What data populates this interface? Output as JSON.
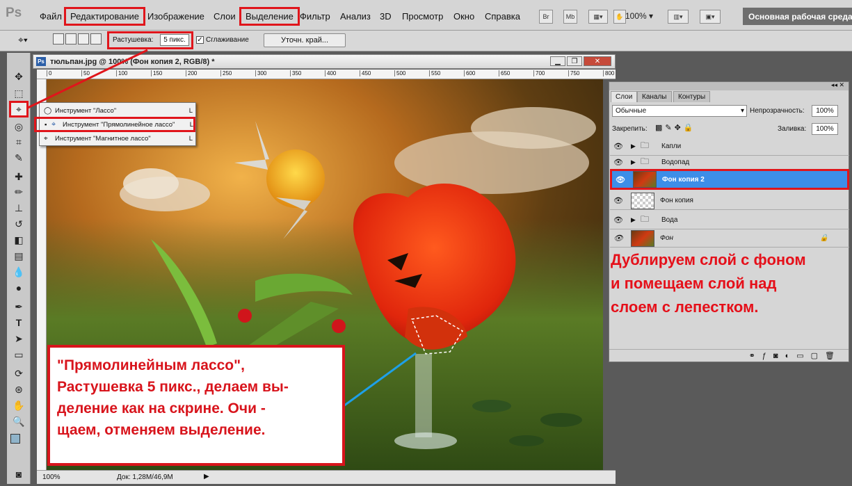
{
  "app": {
    "logo": "Ps"
  },
  "menu": [
    "Файл",
    "Редактирование",
    "Изображение",
    "Слои",
    "Выделение",
    "Фильтр",
    "Анализ",
    "3D",
    "Просмотр",
    "Окно",
    "Справка"
  ],
  "appbar": {
    "bridge": "Br",
    "minibridge": "Mb",
    "zoom": "100%",
    "workspace": "Основная рабочая среда"
  },
  "options": {
    "feather_label": "Растушевка:",
    "feather_value": "5 пикс.",
    "antialias_label": "Сглаживание",
    "refine_edge": "Уточн. край..."
  },
  "document": {
    "title": "тюльпан.jpg @ 100% (Фон копия 2, RGB/8) *",
    "ruler_ticks": [
      "0",
      "50",
      "100",
      "150",
      "200",
      "250",
      "300",
      "350",
      "400",
      "450",
      "500",
      "550",
      "600",
      "650",
      "700",
      "750",
      "800"
    ],
    "status_zoom": "100%",
    "status_doc": "Док: 1,28M/46,9M"
  },
  "flyout": {
    "items": [
      {
        "label": "Инструмент \"Лассо\"",
        "key": "L"
      },
      {
        "label": "Инструмент \"Прямолинейное лассо\"",
        "key": "L"
      },
      {
        "label": "Инструмент \"Магнитное лассо\"",
        "key": "L"
      }
    ]
  },
  "layers_panel": {
    "tabs": [
      "Слои",
      "Каналы",
      "Контуры"
    ],
    "blend_mode": "Обычные",
    "opacity_label": "Непрозрачность:",
    "opacity_value": "100%",
    "lock_label": "Закрепить:",
    "fill_label": "Заливка:",
    "fill_value": "100%",
    "layers": [
      {
        "name": "Капли",
        "type": "group"
      },
      {
        "name": "Водопад",
        "type": "group"
      },
      {
        "name": "Фон копия 2",
        "type": "image",
        "selected": true
      },
      {
        "name": "Фон копия",
        "type": "transparent"
      },
      {
        "name": "Вода",
        "type": "group"
      },
      {
        "name": "Фон",
        "type": "image",
        "locked": true
      }
    ]
  },
  "annotations": {
    "right": [
      "Дублируем слой с фоном",
      "и помещаем слой над",
      "слоем с лепестком."
    ],
    "bottom": [
      "\"Прямолинейным лассо\",",
      "Растушевка 5 пикс., делаем вы-",
      "деление как на скрине. Очи -",
      "щаем, отменяем выделение."
    ]
  },
  "colors": {
    "accent_red": "#e0151b",
    "selection_blue": "#3d8ee8"
  }
}
